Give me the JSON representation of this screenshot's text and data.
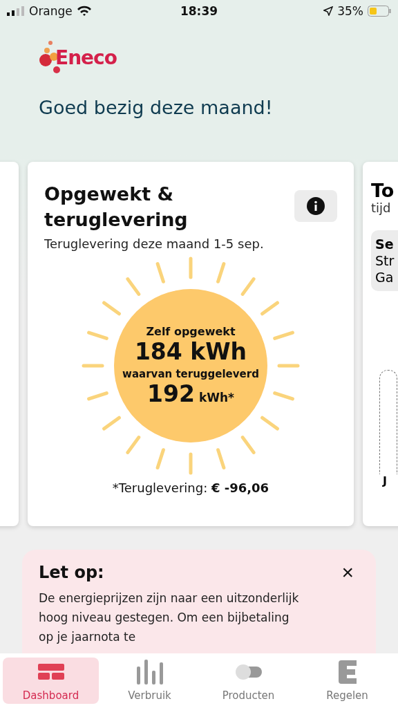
{
  "status_bar": {
    "carrier": "Orange",
    "time": "18:39",
    "battery": "35%"
  },
  "header": {
    "logo_text": "Eneco",
    "greeting": "Goed bezig deze maand!"
  },
  "cards": [
    {
      "kind": "empty"
    },
    {
      "kind": "solar",
      "title": "Opgewekt & teruglevering",
      "subtitle": "Teruglevering deze maand 1-5 sep.",
      "generated_label": "Zelf opgewekt",
      "generated_value": "184 kWh",
      "returned_label": "waarvan teruggeleverd",
      "returned_value": "192",
      "returned_unit": "kWh*",
      "footnote": "*Teruglevering: **€ -96,06**"
    },
    {
      "kind": "partial",
      "title": "To",
      "subtitle": "tijd",
      "lines": [
        "Se",
        "Str",
        "Ga"
      ],
      "axis_label": "J"
    }
  ],
  "notice": {
    "title": "Let op:",
    "close": "×",
    "text": "De energieprijzen zijn naar een uitzonderlijk hoog niveau gestegen. Om een bijbetaling op je jaarnota te"
  },
  "nav": [
    {
      "kind": "dashboard",
      "label": "Dashboard",
      "selected": true
    },
    {
      "kind": "usage",
      "label": "Verbruik",
      "selected": false
    },
    {
      "kind": "products",
      "label": "Producten",
      "selected": false
    },
    {
      "kind": "control",
      "label": "Regelen",
      "selected": false
    }
  ]
}
